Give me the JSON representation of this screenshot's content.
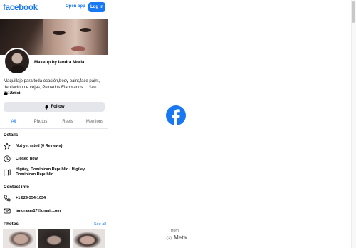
{
  "header": {
    "logo_text": "facebook",
    "open_app_label": "Open app",
    "login_label": "Log in"
  },
  "profile": {
    "name": "Makeup by Iandra Morla",
    "bio": "Maquillaje para toda ocasión,body paint,face paint, depilacion de cejas, Peinados Elaborados ...",
    "see_more": "See more",
    "category": "Artist",
    "follow_label": "Follow"
  },
  "tabs": [
    "All",
    "Photos",
    "Reels",
    "Mentions"
  ],
  "details": {
    "title": "Details",
    "items": [
      {
        "icon": "star-icon",
        "text": "Not yet rated (0 Reviews)"
      },
      {
        "icon": "clock-icon",
        "text": "Closed now"
      },
      {
        "icon": "map-icon",
        "text": "Higüey, Dominican Republic · Higüey, Dominican Republic"
      }
    ]
  },
  "contact": {
    "title": "Contact info",
    "items": [
      {
        "icon": "phone-icon",
        "text": "+1 829-354-1034"
      },
      {
        "icon": "mail-icon",
        "text": "iandraam17@gmail.com"
      }
    ]
  },
  "photos": {
    "title": "Photos",
    "see_all": "See all"
  },
  "splash": {
    "from": "from",
    "meta": "Meta"
  },
  "colors": {
    "brand": "#1877f2",
    "secondary_text": "#65676b",
    "button_gray": "#e4e6eb"
  }
}
